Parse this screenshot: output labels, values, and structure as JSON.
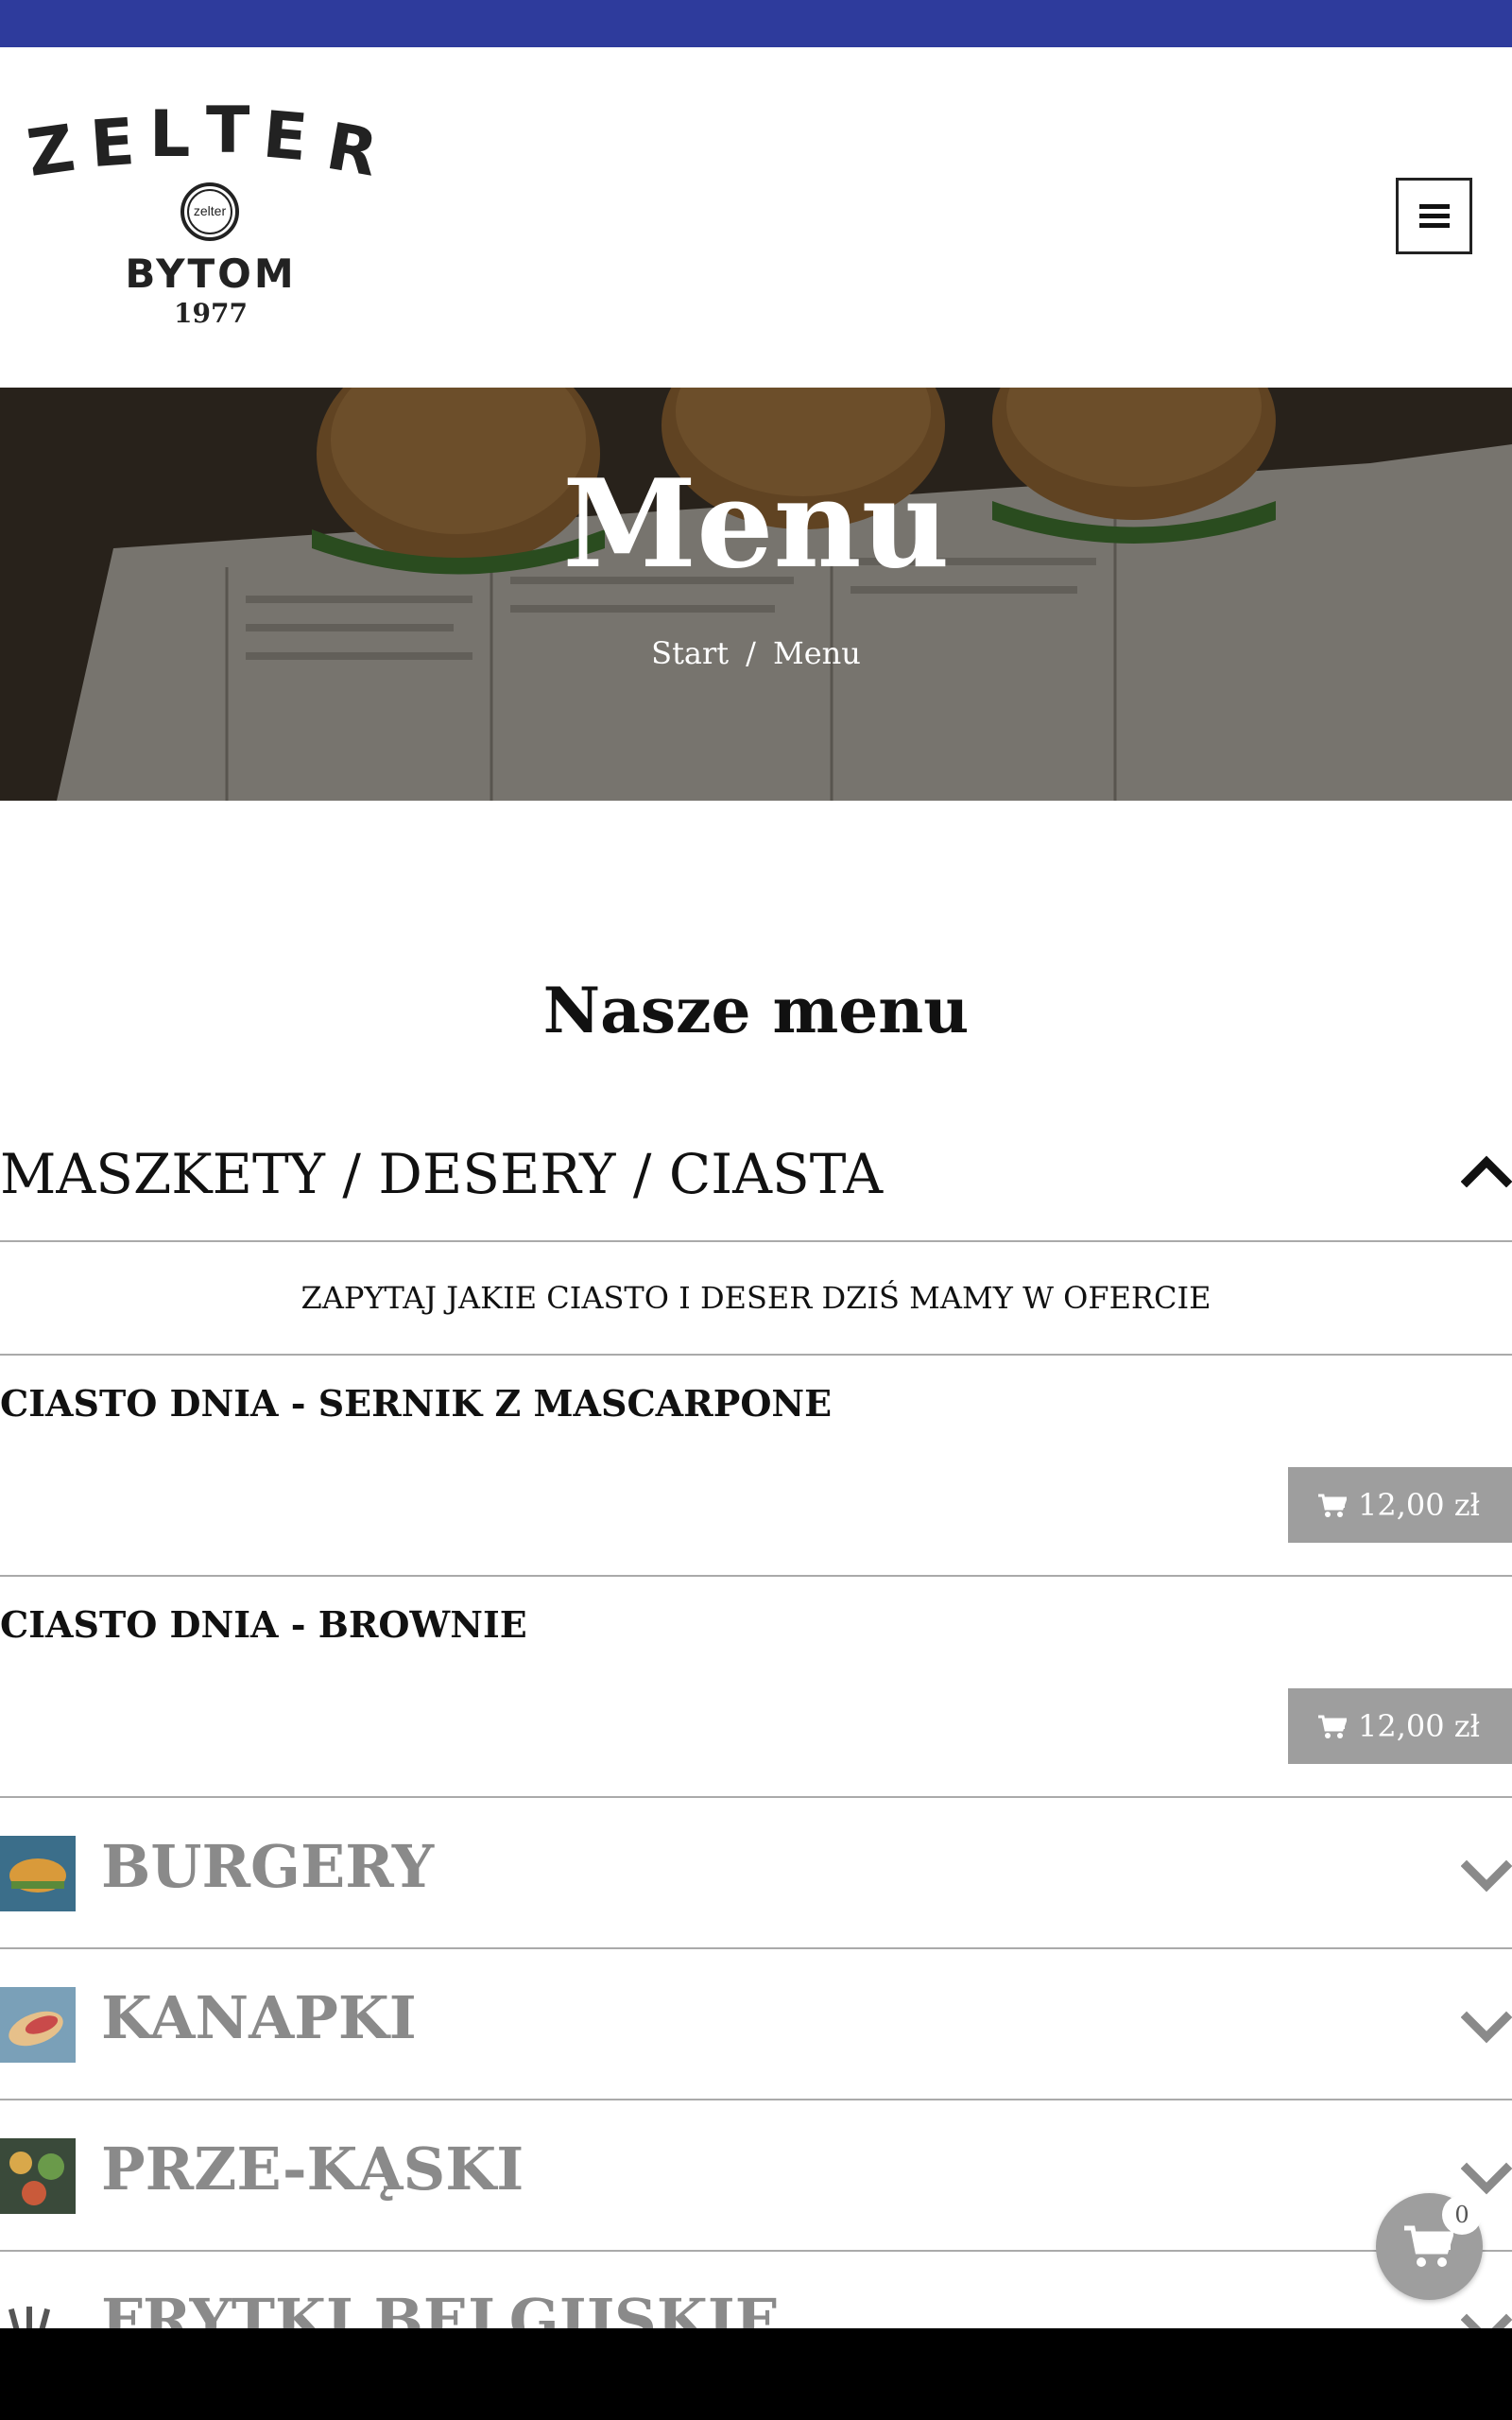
{
  "colors": {
    "top_bar": "#2e3b9c",
    "price_button": "#9e9e9e",
    "category_text": "#8a8a8a"
  },
  "logo": {
    "wordmark": "ZELTER",
    "badge": "zelter",
    "city": "BYTOM",
    "year": "1977"
  },
  "header": {
    "menu_icon": "hamburger-icon"
  },
  "hero": {
    "title": "Menu",
    "breadcrumb": {
      "home": "Start",
      "separator": "/",
      "current": "Menu"
    }
  },
  "section": {
    "title": "Nasze menu"
  },
  "open_category": {
    "name": "MASZKETY / DESERY / CIASTA",
    "notice": "ZAPYTAJ JAKIE CIASTO I DESER DZIŚ MAMY W OFERCIE",
    "items": [
      {
        "name": "CIASTO DNIA - SERNIK Z MASCARPONE",
        "price": "12,00 zł"
      },
      {
        "name": "CIASTO DNIA - BROWNIE",
        "price": "12,00 zł"
      }
    ]
  },
  "categories": [
    {
      "name": "BURGERY"
    },
    {
      "name": "KANAPKI"
    },
    {
      "name": "PRZE-KĄSKI"
    },
    {
      "name": "FRYTKI BELGIJSKIE"
    }
  ],
  "cart": {
    "count": "0",
    "icon": "cart-icon"
  }
}
